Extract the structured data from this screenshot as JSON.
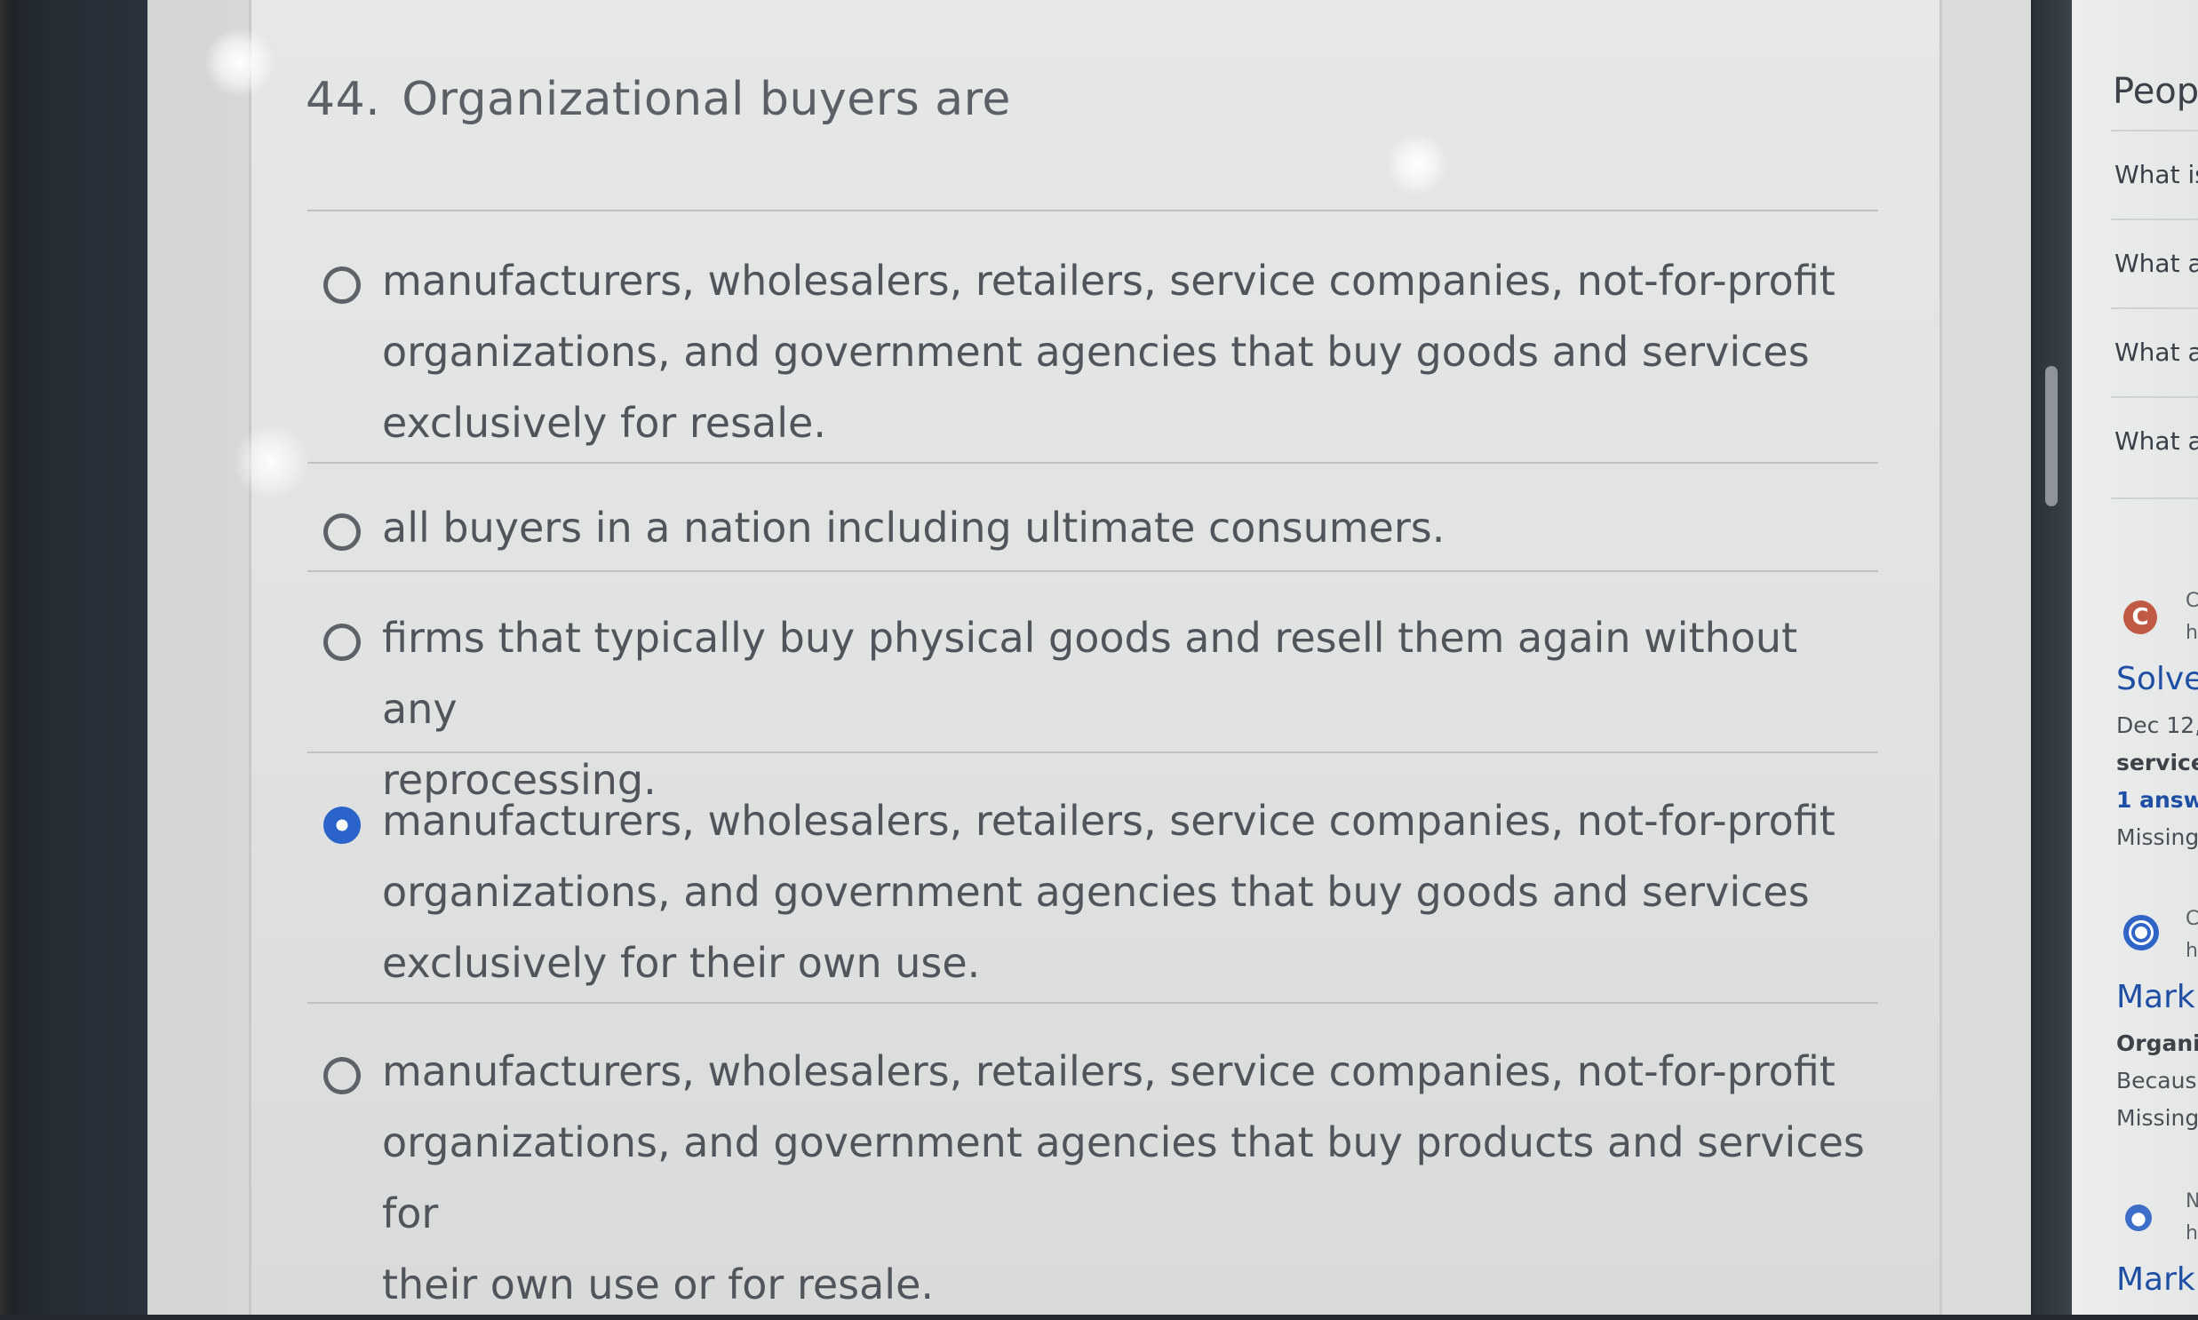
{
  "question": {
    "number": "44.",
    "text": "Organizational buyers are"
  },
  "options": [
    {
      "line1": "manufacturers, wholesalers, retailers, service companies, not-for-profit",
      "line2": "organizations, and government agencies that buy goods and services",
      "line3": "exclusively for resale.",
      "selected": false
    },
    {
      "line1": "all buyers in a nation including ultimate consumers.",
      "selected": false
    },
    {
      "line1": "firms that typically buy physical goods and resell them again without any",
      "line2": "reprocessing.",
      "selected": false
    },
    {
      "line1": "manufacturers, wholesalers, retailers, service companies, not-for-profit",
      "line2": "organizations, and government agencies that buy goods and services",
      "line3": "exclusively for their own use.",
      "selected": true
    },
    {
      "line1": "manufacturers, wholesalers, retailers, service companies, not-for-profit",
      "line2": "organizations, and government agencies that buy products and services for",
      "line3": "their own use or for resale.",
      "selected": false
    }
  ],
  "sidebar": {
    "title": "Peop",
    "questions": [
      "What is",
      "What a",
      "What a",
      "What a"
    ],
    "results": [
      {
        "badge": "C",
        "side_1": "C",
        "side_2": "h",
        "title": "Solve",
        "date": "Dec 12,",
        "snippet": "service",
        "answers": "1 answe",
        "missing": "Missing"
      },
      {
        "side_1": "C",
        "side_2": "h",
        "title": "Mark",
        "snippet1": "Organi:",
        "snippet2": "Becaus",
        "missing": "Missing"
      },
      {
        "side_1": "N",
        "side_2": "h",
        "title": "Mark"
      }
    ]
  }
}
